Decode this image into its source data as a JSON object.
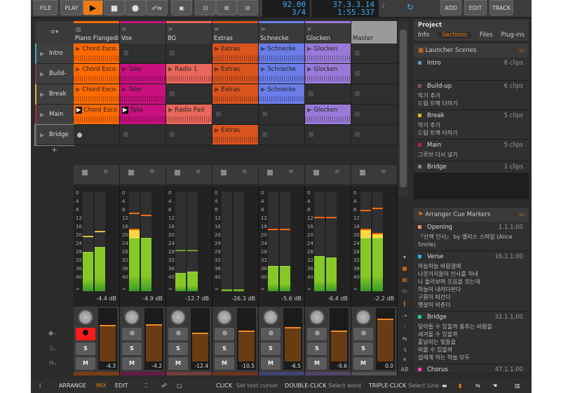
{
  "toolbar": {
    "file": "FILE",
    "play": "PLAY",
    "add": "ADD",
    "edit": "EDIT",
    "track": "TRACK",
    "tempo": "92.00",
    "signature": "3/4",
    "position": "37.3.3.14",
    "time": "1:55.337"
  },
  "tracks": [
    {
      "name": "Piano Flangedi...",
      "color": "#ff6a00",
      "icon": "piano-icon",
      "db": "-4.4 dB",
      "vol": "-4.3",
      "fader": 0.7,
      "levels": [
        26,
        24
      ],
      "peaks": [
        19,
        17
      ],
      "armed": true
    },
    {
      "name": "Vox",
      "color": "#c8107e",
      "icon": "audio-track-icon",
      "db": "-4.9 dB",
      "vol": "-4.2",
      "fader": 0.72,
      "levels": [
        20,
        20
      ],
      "peaks": [
        9,
        10
      ],
      "armed": false
    },
    {
      "name": "BG",
      "color": "#e8665a",
      "icon": "audio-track-icon",
      "db": "-12.7 dB",
      "vol": "-12.4",
      "fader": 0.55,
      "levels": [
        35,
        34.5
      ],
      "peaks": [
        25,
        25
      ],
      "armed": false
    },
    {
      "name": "Extras",
      "color": "#d9541f",
      "icon": "audio-track-icon",
      "db": "-26.3 dB",
      "vol": "-10.5",
      "fader": 0.59,
      "levels": [
        46,
        46
      ],
      "peaks": [
        43,
        45
      ],
      "armed": false
    },
    {
      "name": "Schnecke",
      "color": "#6a7de8",
      "icon": "audio-track-icon",
      "db": "-5.6 dB",
      "vol": "-6.5",
      "fader": 0.66,
      "levels": [
        32,
        32
      ],
      "peaks": [
        16,
        16
      ],
      "armed": false
    },
    {
      "name": "Glocken",
      "color": "#9a7ad8",
      "icon": "audio-track-icon",
      "db": "-6.4 dB",
      "vol": "-9.6",
      "fader": 0.6,
      "levels": [
        28,
        28.5
      ],
      "peaks": [
        11,
        11
      ],
      "armed": false
    },
    {
      "name": "Master",
      "color": "#9a9a9a",
      "icon": "crown-icon",
      "db": "-2.2 dB",
      "vol": "0.0",
      "fader": 0.83,
      "levels": [
        20,
        20
      ],
      "peaks": [
        8,
        7
      ],
      "armed": false
    }
  ],
  "meter_scale": [
    "0",
    "4",
    "8",
    "12",
    "16",
    "20",
    "24",
    "28",
    "32",
    "36",
    "40",
    "∞"
  ],
  "scenes": [
    {
      "name": "Intro",
      "color": "#4aa3b8",
      "clips": [
        "Chord Esco...",
        null,
        null,
        "Extras",
        "Schnecke",
        "Glocken",
        null
      ]
    },
    {
      "name": "Build-up",
      "color": "#7a3a5a",
      "clips": [
        "Chord Esco...",
        "Take",
        "Radio 1",
        "Extras",
        "Schnecke",
        "Glocken",
        null
      ]
    },
    {
      "name": "Break",
      "color": "#e0b030",
      "clips": [
        "Chord Esco...",
        "Take",
        null,
        "Extras",
        "Schnecke",
        null,
        null
      ]
    },
    {
      "name": "Main",
      "color": "#c0203a",
      "clips": [
        "Chord Esco...",
        "Take",
        "Radio Pad",
        null,
        null,
        "Glocken",
        null
      ],
      "playing": [
        0,
        1
      ]
    },
    {
      "name": "Bridge",
      "color": "#666",
      "clips": [
        "rec",
        null,
        null,
        "Extras",
        null,
        null,
        null
      ]
    }
  ],
  "add_scene": "+",
  "mixer_labels": {
    "solo": "S",
    "mute": "M"
  },
  "panel": {
    "title": "Project",
    "tabs": [
      "Info",
      "Sections",
      "Files",
      "Plug-ins"
    ],
    "active_tab": "Sections",
    "launcher_title": "Launcher Scenes",
    "launcher": [
      {
        "name": "Intro",
        "count": "8 clips",
        "color": "#4aa3b8",
        "desc": ""
      },
      {
        "name": "Build-up",
        "count": "6 clips",
        "color": "#8a4a6a",
        "desc": "악기 추가\n드럼 트랙 더하기"
      },
      {
        "name": "Break",
        "count": "5 clips",
        "color": "#e0b030",
        "desc": "악기 추가\n드럼 트랙 더하기"
      },
      {
        "name": "Main",
        "count": "5 clips",
        "color": "#c0203a",
        "desc": "그루브 다시 넣기"
      },
      {
        "name": "Bridge",
        "count": "1 clips",
        "color": "#888",
        "desc": ""
      }
    ],
    "cue_title": "Arranger Cue Markers",
    "cues": [
      {
        "name": "Opening",
        "pos": "1.1.1.00",
        "color": "#e89060",
        "desc": "『산책 인사』 by  엘리스 스마일 (Alice Smile)"
      },
      {
        "name": "Verse",
        "pos": "16.1.1.00",
        "color": "#20b8e0",
        "desc": "하늘하늘 바람결에\n나뭇가지들이 인사를 하네\n나 돌아보며 웃음을 짓는데\n하늘이 내려다본다\n구름이 떠간다\n햇살이 비춘다"
      },
      {
        "name": "Bridge",
        "pos": "32.1.1.00",
        "color": "#20d080",
        "desc": "닿아들 수 있을까 춤추는 바람을\n새겨둘 수 있을까\n흩날리는 빛들을\n머물 수 있을까\n설레게 하는 하늘 모두"
      },
      {
        "name": "Chorus",
        "pos": "47.1.1.00",
        "color": "#f040a0",
        "desc": ""
      }
    ]
  },
  "status": {
    "info": "i",
    "arrange": "ARRANGE",
    "mix": "MIX",
    "edit": "EDIT",
    "click": "CLICK",
    "click_desc": "Set text cursor",
    "dclick": "DOUBLE-CLICK",
    "dclick_desc": "Select word",
    "tclick": "TRIPLE-CLICK",
    "tclick_desc": "Select Line"
  },
  "colors": {
    "accent": "#f07a14",
    "display": "#3fa9f5",
    "meter": "#86c926",
    "record": "#ff1a1a"
  }
}
